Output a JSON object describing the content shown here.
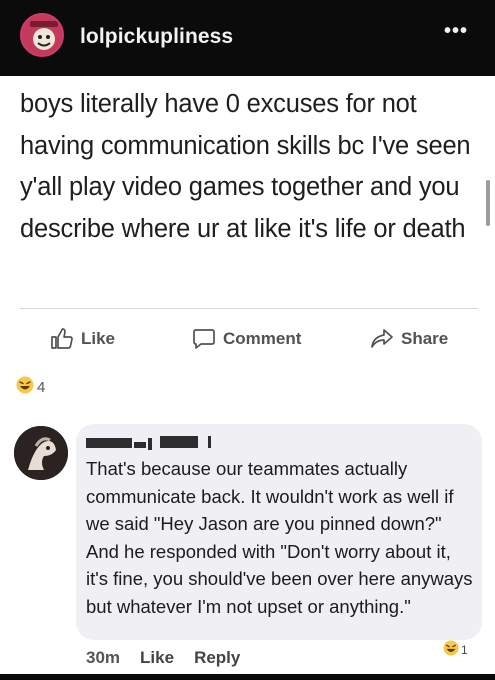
{
  "header": {
    "page_name": "lolpickupliness",
    "more_label": "•••"
  },
  "post": {
    "text": "boys literally have 0 excuses for not having communication skills bc I've seen y'all play video games together and you describe where ur at like it's life or death"
  },
  "actions": {
    "like": "Like",
    "comment": "Comment",
    "share": "Share"
  },
  "reactions": {
    "count": "4",
    "icon": "laughing-emoji-icon"
  },
  "comment": {
    "author_name": "[redacted]",
    "text": "That's because our teammates actually communicate back. It wouldn't work as well if we said \"Hey Jason are you pinned down?\" And he responded with \"Don't worry about it, it's fine, you should've been over here anyways but whatever I'm not upset or anything.\"",
    "time": "30m",
    "like_label": "Like",
    "reply_label": "Reply",
    "reaction_count": "1"
  },
  "colors": {
    "header_bg": "#0b0b0b",
    "bubble_bg": "#efeff4",
    "action_text": "#525252"
  }
}
